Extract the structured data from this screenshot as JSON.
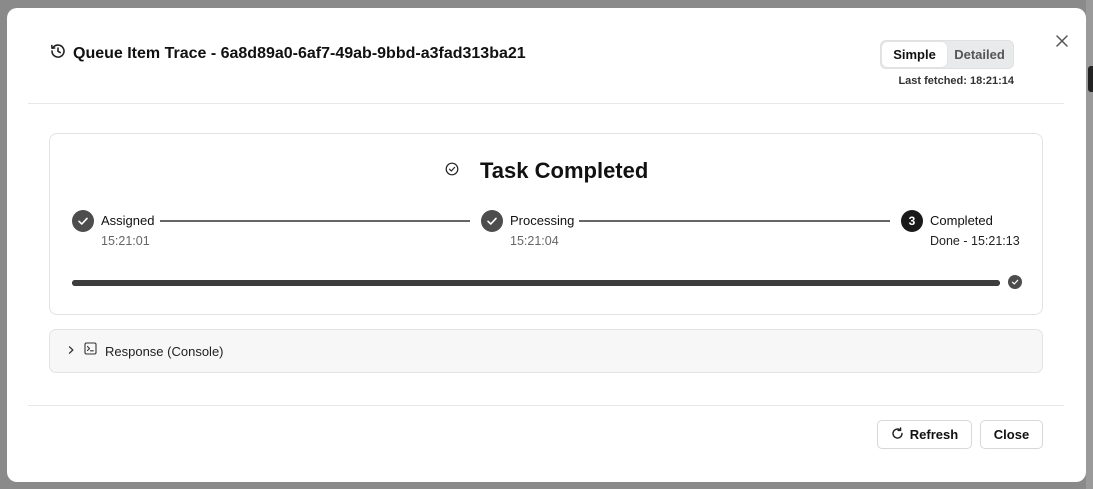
{
  "dialog": {
    "title": "Queue Item Trace - 6a8d89a0-6af7-49ab-9bbd-a3fad313ba21",
    "view_toggle": {
      "options": [
        "Simple",
        "Detailed"
      ],
      "selected": "Simple"
    },
    "last_fetched": "Last fetched: 18:21:14"
  },
  "status": {
    "title": "Task Completed",
    "steps": [
      {
        "label": "Assigned",
        "time": "15:21:01",
        "state": "done"
      },
      {
        "label": "Processing",
        "time": "15:21:04",
        "state": "done"
      },
      {
        "label": "Completed",
        "time": "Done - 15:21:13",
        "state": "current",
        "number": "3"
      }
    ],
    "progress_fraction": 1.0
  },
  "response": {
    "label": "Response (Console)",
    "expanded": false
  },
  "footer": {
    "refresh_label": "Refresh",
    "close_label": "Close"
  },
  "colors": {
    "step_done": "#4d4d4d",
    "step_current": "#1a1a1a",
    "progress": "#3d3d3d"
  }
}
